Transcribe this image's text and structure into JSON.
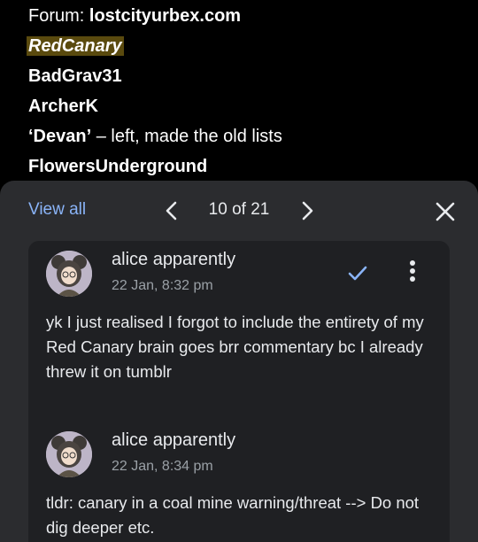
{
  "document": {
    "forum_label": "Forum:",
    "forum_value": "lostcityurbex.com",
    "names": [
      "RedCanary",
      "BadGrav31",
      "ArcherK"
    ],
    "devan_name": "‘Devan’",
    "devan_note": " – left, made the old lists",
    "last_name": "FlowersUnderground"
  },
  "panel": {
    "view_all_label": "View all",
    "counter": "10 of 21",
    "accent_color": "#8ab4f8",
    "icons": {
      "prev": "chevron-left-icon",
      "next": "chevron-right-icon",
      "close": "close-icon",
      "resolve": "check-icon",
      "more": "more-vert-icon"
    }
  },
  "comments": [
    {
      "author": "alice apparently",
      "time": "22 Jan, 8:32 pm",
      "text": "yk I just realised I forgot to include the entirety of my Red Canary brain goes brr commentary bc I already threw it on tumblr"
    },
    {
      "author": "alice apparently",
      "time": "22 Jan, 8:34 pm",
      "text": "tldr: canary in a coal mine warning/threat --> Do not dig deeper etc."
    }
  ]
}
